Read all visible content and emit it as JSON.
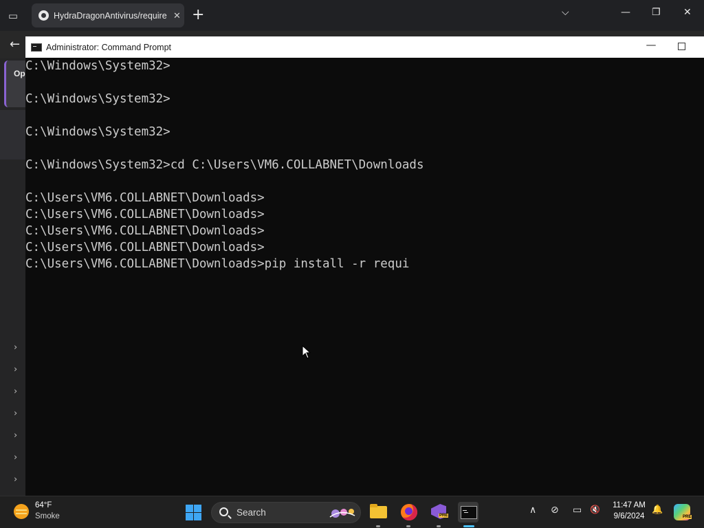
{
  "browser": {
    "tab_title": "HydraDragonAntivirus/require",
    "tab_close": "✕",
    "new_tab": "+",
    "tab_list": "⌵",
    "minimize": "—",
    "restore": "❐",
    "close": "✕",
    "back": "←",
    "side_card_label": "Op"
  },
  "cmd": {
    "window_title": "Administrator: Command Prompt",
    "minimize": "—",
    "lines": [
      "C:\\Windows\\System32>",
      "",
      "C:\\Windows\\System32>",
      "",
      "C:\\Windows\\System32>",
      "",
      "C:\\Windows\\System32>cd C:\\Users\\VM6.COLLABNET\\Downloads",
      "",
      "C:\\Users\\VM6.COLLABNET\\Downloads>",
      "C:\\Users\\VM6.COLLABNET\\Downloads>",
      "C:\\Users\\VM6.COLLABNET\\Downloads>",
      "C:\\Users\\VM6.COLLABNET\\Downloads>",
      "C:\\Users\\VM6.COLLABNET\\Downloads>pip install -r requi"
    ],
    "colors": {
      "background": "#0c0c0c",
      "text": "#cccccc"
    }
  },
  "taskbar": {
    "weather_temp": "64°F",
    "weather_condition": "Smoke",
    "search_label": "Search",
    "apps": [
      "file-explorer-icon",
      "firefox-icon",
      "visual-studio-preview-icon",
      "command-prompt-icon"
    ],
    "tray": {
      "chevron": "∧",
      "network": "⊘",
      "display": "▭",
      "volume": "🔇"
    },
    "time": "11:47 AM",
    "date": "9/6/2024",
    "notification": "🔔",
    "copilot_badge": "PRE"
  }
}
